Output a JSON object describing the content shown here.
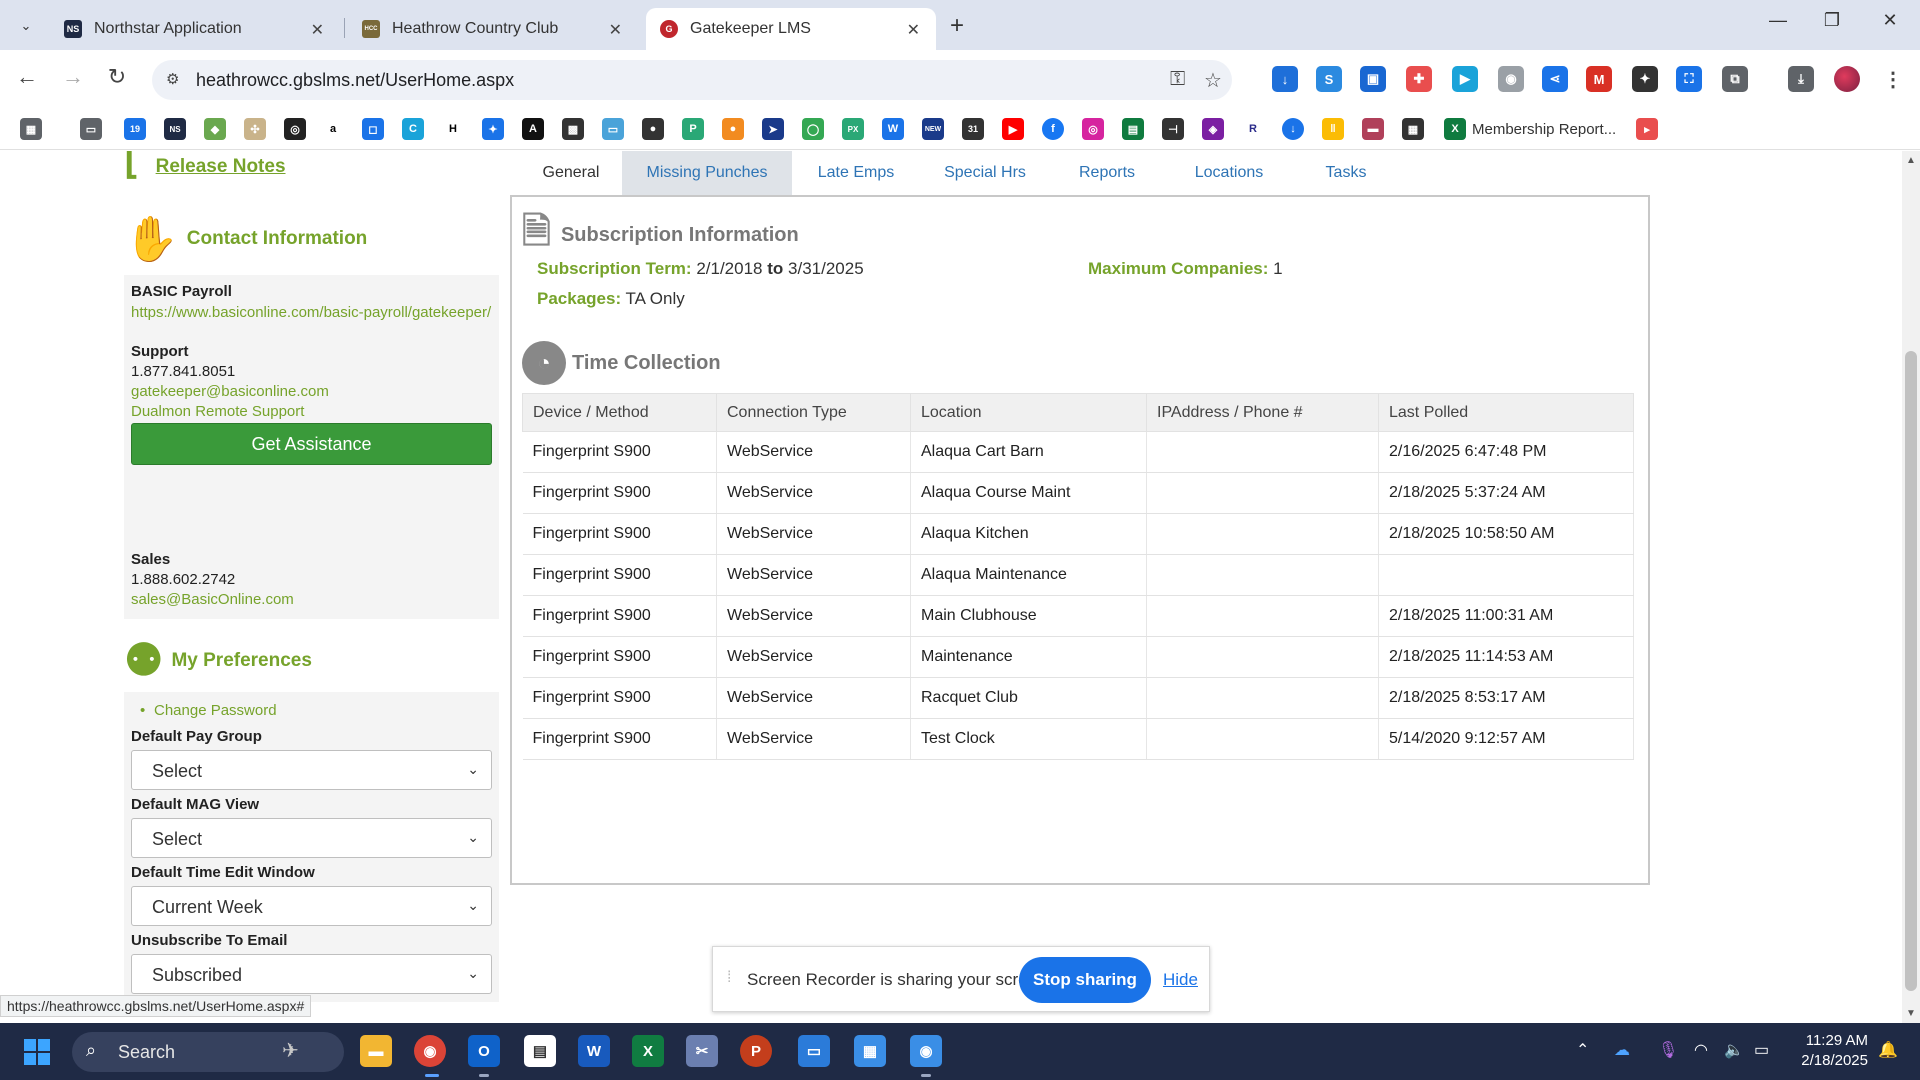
{
  "browser": {
    "tabs": [
      {
        "title": "Northstar Application",
        "favicon": "NS"
      },
      {
        "title": "Heathrow Country Club",
        "favicon": "HCC"
      },
      {
        "title": "Gatekeeper LMS",
        "favicon": "G"
      }
    ],
    "active_tab": 2,
    "url": "heathrowcc.gbslms.net/UserHome.aspx",
    "bookmark_label": "Membership Report...",
    "status_url": "https://heathrowcc.gbslms.net/UserHome.aspx#"
  },
  "sidebar": {
    "release_notes": "Release Notes",
    "contact_heading": "Contact Information",
    "company": "BASIC Payroll",
    "company_url": "https://www.basiconline.com/basic-payroll/gatekeeper/",
    "support_label": "Support",
    "support_phone": "1.877.841.8051",
    "support_email": "gatekeeper@basiconline.com",
    "remote_support": "Dualmon Remote Support",
    "assist_button": "Get Assistance",
    "sales_label": "Sales",
    "sales_phone": "1.888.602.2742",
    "sales_email": "sales@BasicOnline.com",
    "prefs_heading": "My Preferences",
    "change_password": "Change Password",
    "default_pay_group_label": "Default Pay Group",
    "default_pay_group_value": "Select",
    "default_mag_view_label": "Default MAG View",
    "default_mag_view_value": "Select",
    "default_time_edit_label": "Default Time Edit Window",
    "default_time_edit_value": "Current Week",
    "unsubscribe_label": "Unsubscribe To Email",
    "unsubscribe_value": "Subscribed"
  },
  "main": {
    "tabs": [
      "General",
      "Missing Punches",
      "Late Emps",
      "Special Hrs",
      "Reports",
      "Locations",
      "Tasks"
    ],
    "subscription_heading": "Subscription Information",
    "subscription_term_label": "Subscription Term:",
    "subscription_start": "2/1/2018",
    "subscription_to": "to",
    "subscription_end": "3/31/2025",
    "max_companies_label": "Maximum Companies:",
    "max_companies_value": "1",
    "packages_label": "Packages:",
    "packages_value": "TA Only",
    "time_collection_heading": "Time Collection",
    "table": {
      "headers": [
        "Device / Method",
        "Connection Type",
        "Location",
        "IPAddress / Phone #",
        "Last Polled"
      ],
      "rows": [
        [
          "Fingerprint S900",
          "WebService",
          "Alaqua Cart Barn",
          "",
          "2/16/2025 6:47:48 PM"
        ],
        [
          "Fingerprint S900",
          "WebService",
          "Alaqua Course Maint",
          "",
          "2/18/2025 5:37:24 AM"
        ],
        [
          "Fingerprint S900",
          "WebService",
          "Alaqua Kitchen",
          "",
          "2/18/2025 10:58:50 AM"
        ],
        [
          "Fingerprint S900",
          "WebService",
          "Alaqua Maintenance",
          "",
          ""
        ],
        [
          "Fingerprint S900",
          "WebService",
          "Main Clubhouse",
          "",
          "2/18/2025 11:00:31 AM"
        ],
        [
          "Fingerprint S900",
          "WebService",
          "Maintenance",
          "",
          "2/18/2025 11:14:53 AM"
        ],
        [
          "Fingerprint S900",
          "WebService",
          "Racquet Club",
          "",
          "2/18/2025 8:53:17 AM"
        ],
        [
          "Fingerprint S900",
          "WebService",
          "Test Clock",
          "",
          "5/14/2020 9:12:57 AM"
        ]
      ]
    }
  },
  "share_bar": {
    "message": "Screen Recorder is sharing your screen.",
    "stop_label": "Stop sharing",
    "hide_label": "Hide"
  },
  "taskbar": {
    "search_label": "Search",
    "time": "11:29 AM",
    "date": "2/18/2025"
  },
  "colors": {
    "accent_green": "#76a32b",
    "button_green": "#3a9a3a",
    "tab_link_blue": "#2e74b5",
    "stop_blue": "#1a73e8"
  }
}
